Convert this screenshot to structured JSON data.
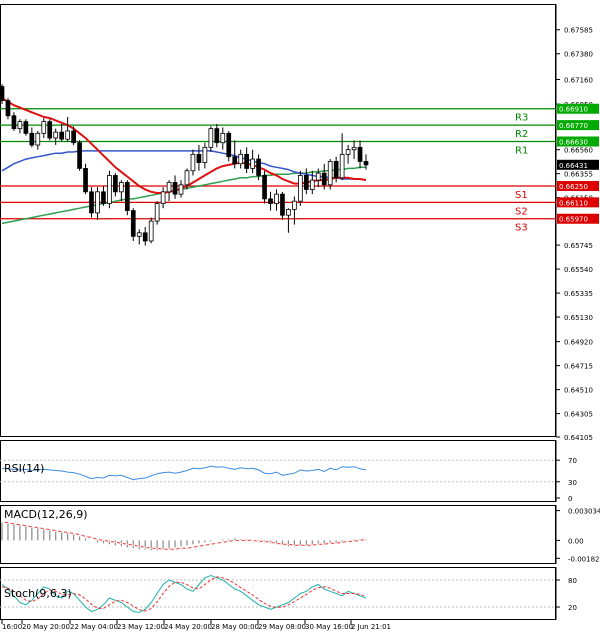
{
  "chart_data": {
    "type": "candlestick",
    "main": {
      "ylim": [
        0.64105,
        0.67805
      ],
      "y_ticks": [
        "0.67585",
        "0.67380",
        "0.67160",
        "0.66950",
        "0.66560",
        "0.66355",
        "0.66150",
        "0.65745",
        "0.65540",
        "0.65335",
        "0.65130",
        "0.64920",
        "0.64715",
        "0.64510",
        "0.64305",
        "0.64105"
      ],
      "price_tags": [
        {
          "value": 0.6691,
          "label": "0.66910",
          "bg": "#00aa00"
        },
        {
          "value": 0.6677,
          "label": "0.66770",
          "bg": "#00aa00"
        },
        {
          "value": 0.6663,
          "label": "0.66630",
          "bg": "#00aa00"
        },
        {
          "value": 0.66431,
          "label": "0.66431",
          "bg": "#000000"
        },
        {
          "value": 0.6625,
          "label": "0.66250",
          "bg": "#dd0000"
        },
        {
          "value": 0.6611,
          "label": "0.66110",
          "bg": "#dd0000"
        },
        {
          "value": 0.6597,
          "label": "0.65970",
          "bg": "#dd0000"
        }
      ],
      "levels": [
        {
          "name": "R3",
          "value": 0.6691,
          "color": "#008800"
        },
        {
          "name": "R2",
          "value": 0.6677,
          "color": "#008800"
        },
        {
          "name": "R1",
          "value": 0.6663,
          "color": "#008800"
        },
        {
          "name": "S1",
          "value": 0.6625,
          "color": "#dd0000"
        },
        {
          "name": "S2",
          "value": 0.6611,
          "color": "#dd0000"
        },
        {
          "name": "S3",
          "value": 0.6597,
          "color": "#dd0000"
        }
      ],
      "candles": [
        [
          0.671,
          0.6712,
          0.6695,
          0.6698
        ],
        [
          0.6698,
          0.67,
          0.6682,
          0.6685
        ],
        [
          0.6685,
          0.6688,
          0.6672,
          0.6674
        ],
        [
          0.6674,
          0.6682,
          0.667,
          0.668
        ],
        [
          0.668,
          0.6682,
          0.6668,
          0.667
        ],
        [
          0.667,
          0.6675,
          0.6658,
          0.666
        ],
        [
          0.666,
          0.6672,
          0.6656,
          0.667
        ],
        [
          0.667,
          0.6683,
          0.6666,
          0.668
        ],
        [
          0.668,
          0.6682,
          0.6664,
          0.6666
        ],
        [
          0.6666,
          0.6674,
          0.666,
          0.6671
        ],
        [
          0.6671,
          0.6678,
          0.6663,
          0.6665
        ],
        [
          0.6665,
          0.6684,
          0.6663,
          0.6672
        ],
        [
          0.6672,
          0.6676,
          0.666,
          0.6662
        ],
        [
          0.6662,
          0.6664,
          0.6638,
          0.664
        ],
        [
          0.664,
          0.6644,
          0.6618,
          0.662
        ],
        [
          0.662,
          0.6624,
          0.6598,
          0.6602
        ],
        [
          0.6602,
          0.6624,
          0.6596,
          0.662
        ],
        [
          0.662,
          0.6625,
          0.6608,
          0.661
        ],
        [
          0.661,
          0.6638,
          0.6606,
          0.6634
        ],
        [
          0.6634,
          0.6636,
          0.6616,
          0.662
        ],
        [
          0.662,
          0.663,
          0.6612,
          0.6628
        ],
        [
          0.6628,
          0.663,
          0.66,
          0.6604
        ],
        [
          0.6604,
          0.6606,
          0.6578,
          0.6582
        ],
        [
          0.6582,
          0.6588,
          0.6575,
          0.6585
        ],
        [
          0.6585,
          0.659,
          0.6574,
          0.6578
        ],
        [
          0.6578,
          0.6598,
          0.6576,
          0.6595
        ],
        [
          0.6595,
          0.6612,
          0.6592,
          0.661
        ],
        [
          0.661,
          0.6624,
          0.6606,
          0.662
        ],
        [
          0.662,
          0.663,
          0.6612,
          0.6628
        ],
        [
          0.6628,
          0.6634,
          0.6614,
          0.6618
        ],
        [
          0.6618,
          0.663,
          0.6615,
          0.6626
        ],
        [
          0.6626,
          0.664,
          0.6622,
          0.6638
        ],
        [
          0.6638,
          0.6656,
          0.6634,
          0.6652
        ],
        [
          0.6652,
          0.666,
          0.6638,
          0.6645
        ],
        [
          0.6645,
          0.6662,
          0.664,
          0.6658
        ],
        [
          0.6658,
          0.6676,
          0.6654,
          0.6674
        ],
        [
          0.6674,
          0.6678,
          0.6658,
          0.6662
        ],
        [
          0.6662,
          0.6675,
          0.6656,
          0.667
        ],
        [
          0.667,
          0.6672,
          0.6646,
          0.665
        ],
        [
          0.665,
          0.6664,
          0.664,
          0.6644
        ],
        [
          0.6644,
          0.6656,
          0.664,
          0.6652
        ],
        [
          0.6652,
          0.6658,
          0.6636,
          0.664
        ],
        [
          0.664,
          0.6656,
          0.6636,
          0.6648
        ],
        [
          0.6648,
          0.6652,
          0.663,
          0.6634
        ],
        [
          0.6634,
          0.6638,
          0.661,
          0.6614
        ],
        [
          0.6614,
          0.662,
          0.6604,
          0.661
        ],
        [
          0.661,
          0.6622,
          0.6604,
          0.6618
        ],
        [
          0.6618,
          0.662,
          0.6596,
          0.66
        ],
        [
          0.66,
          0.6606,
          0.6585,
          0.6605
        ],
        [
          0.6605,
          0.6616,
          0.6592,
          0.6612
        ],
        [
          0.6612,
          0.6638,
          0.6608,
          0.6634
        ],
        [
          0.6634,
          0.664,
          0.6618,
          0.6622
        ],
        [
          0.6622,
          0.6638,
          0.6618,
          0.663
        ],
        [
          0.663,
          0.664,
          0.6624,
          0.6636
        ],
        [
          0.6636,
          0.6644,
          0.6622,
          0.6626
        ],
        [
          0.6626,
          0.6648,
          0.6622,
          0.6646
        ],
        [
          0.6646,
          0.665,
          0.6628,
          0.6632
        ],
        [
          0.6632,
          0.667,
          0.663,
          0.6652
        ],
        [
          0.6652,
          0.666,
          0.6644,
          0.6656
        ],
        [
          0.6656,
          0.6664,
          0.6648,
          0.6658
        ],
        [
          0.6658,
          0.6664,
          0.664,
          0.6646
        ],
        [
          0.6646,
          0.6652,
          0.6639,
          0.6643
        ]
      ],
      "ma_red": [
        0.67,
        0.6697,
        0.6694,
        0.6692,
        0.669,
        0.6688,
        0.6686,
        0.6684,
        0.6683,
        0.6681,
        0.6679,
        0.6677,
        0.6674,
        0.667,
        0.6666,
        0.6661,
        0.6656,
        0.6651,
        0.6646,
        0.6641,
        0.6637,
        0.6633,
        0.6629,
        0.6625,
        0.6622,
        0.662,
        0.6619,
        0.6619,
        0.662,
        0.6621,
        0.6623,
        0.6625,
        0.6628,
        0.6631,
        0.6634,
        0.6637,
        0.664,
        0.6642,
        0.6643,
        0.6644,
        0.6645,
        0.6644,
        0.6643,
        0.6641,
        0.6639,
        0.6636,
        0.6634,
        0.6631,
        0.6629,
        0.6627,
        0.6627,
        0.6628,
        0.6629,
        0.663,
        0.663,
        0.6631,
        0.6632,
        0.6632,
        0.6632,
        0.6631,
        0.6631,
        0.663
      ],
      "ma_blue": [
        0.6638,
        0.6641,
        0.6644,
        0.6646,
        0.6648,
        0.6649,
        0.665,
        0.6651,
        0.6652,
        0.6653,
        0.6653,
        0.6654,
        0.6654,
        0.6655,
        0.6655,
        0.6655,
        0.6655,
        0.6655,
        0.6655,
        0.6655,
        0.6655,
        0.6655,
        0.6655,
        0.6655,
        0.6655,
        0.6655,
        0.6655,
        0.6655,
        0.6655,
        0.6655,
        0.6655,
        0.6655,
        0.6655,
        0.6655,
        0.6655,
        0.6655,
        0.6654,
        0.6653,
        0.6652,
        0.6651,
        0.6649,
        0.6648,
        0.6646,
        0.6645,
        0.6644,
        0.6642,
        0.6641,
        0.664,
        0.6639,
        0.6637,
        0.6636,
        0.6635,
        0.6634,
        0.6633,
        0.6633,
        0.6632,
        0.6632,
        0.6631,
        0.6631,
        0.6631,
        0.6631,
        0.663
      ],
      "ma_green": [
        0.6593,
        0.6594,
        0.6595,
        0.6596,
        0.6597,
        0.6598,
        0.6599,
        0.66,
        0.6601,
        0.6602,
        0.6603,
        0.6604,
        0.6605,
        0.6606,
        0.6607,
        0.6608,
        0.6609,
        0.661,
        0.6611,
        0.6612,
        0.6613,
        0.6614,
        0.6614,
        0.6615,
        0.6616,
        0.6617,
        0.6618,
        0.6619,
        0.662,
        0.6621,
        0.6622,
        0.6623,
        0.6624,
        0.6625,
        0.6626,
        0.6627,
        0.6628,
        0.6629,
        0.663,
        0.6631,
        0.6632,
        0.6632,
        0.6633,
        0.6633,
        0.6634,
        0.6634,
        0.6635,
        0.6635,
        0.6635,
        0.6636,
        0.6636,
        0.6636,
        0.6637,
        0.6637,
        0.6638,
        0.6638,
        0.6639,
        0.6639,
        0.664,
        0.664,
        0.6641,
        0.6641
      ]
    },
    "rsi": {
      "label": "RSI(14)",
      "ylim": [
        0,
        100
      ],
      "ticks": [
        "70",
        "30",
        "0"
      ],
      "values": [
        55,
        54,
        53,
        52,
        53,
        51,
        52,
        53,
        52,
        51,
        50,
        48,
        47,
        44,
        40,
        36,
        38,
        37,
        42,
        41,
        42,
        38,
        34,
        36,
        37,
        41,
        45,
        47,
        48,
        46,
        48,
        51,
        55,
        54,
        56,
        59,
        57,
        58,
        55,
        53,
        56,
        54,
        55,
        52,
        46,
        45,
        48,
        42,
        44,
        46,
        52,
        50,
        51,
        53,
        49,
        55,
        52,
        58,
        57,
        58,
        54,
        52
      ]
    },
    "macd": {
      "label": "MACD(12,26,9)",
      "ylim": [
        -0.002,
        0.0032
      ],
      "ticks": [
        "0.003034",
        "0.00",
        "-0.001826"
      ],
      "hist": [
        0.0018,
        0.0017,
        0.0016,
        0.0015,
        0.0014,
        0.0013,
        0.0012,
        0.0011,
        0.001,
        0.0009,
        0.0008,
        0.0007,
        0.0006,
        0.0004,
        0.0002,
        0.0,
        -0.0002,
        -0.0003,
        -0.0004,
        -0.0005,
        -0.0006,
        -0.0007,
        -0.0008,
        -0.0009,
        -0.0009,
        -0.001,
        -0.001,
        -0.0009,
        -0.0008,
        -0.0007,
        -0.0006,
        -0.0005,
        -0.0004,
        -0.0003,
        -0.0002,
        -0.0001,
        0.0,
        0.0001,
        0.0001,
        0.0002,
        0.0001,
        0.0001,
        0.0,
        -0.0001,
        -0.0002,
        -0.0003,
        -0.0004,
        -0.0005,
        -0.0006,
        -0.0006,
        -0.0005,
        -0.0005,
        -0.0004,
        -0.0003,
        -0.0003,
        -0.0002,
        -0.0002,
        -0.0001,
        0.0,
        0.0001,
        0.0001,
        0.0001
      ],
      "signal": [
        0.0019,
        0.0018,
        0.0017,
        0.0016,
        0.0015,
        0.0014,
        0.0013,
        0.0012,
        0.0011,
        0.001,
        0.0009,
        0.0008,
        0.0007,
        0.0006,
        0.0004,
        0.0003,
        0.0001,
        0.0,
        -0.0001,
        -0.0002,
        -0.0003,
        -0.0004,
        -0.0005,
        -0.0006,
        -0.0007,
        -0.0008,
        -0.0008,
        -0.0009,
        -0.0009,
        -0.0009,
        -0.0008,
        -0.0008,
        -0.0007,
        -0.0006,
        -0.0005,
        -0.0004,
        -0.0003,
        -0.0002,
        -0.0001,
        0.0,
        0.0,
        0.0,
        0.0,
        -0.0001,
        -0.0001,
        -0.0002,
        -0.0003,
        -0.0004,
        -0.0004,
        -0.0005,
        -0.0005,
        -0.0005,
        -0.0005,
        -0.0004,
        -0.0004,
        -0.0003,
        -0.0003,
        -0.0002,
        -0.0001,
        -0.0001,
        0.0,
        0.0001
      ]
    },
    "stoch": {
      "label": "Stoch(9,6,3)",
      "ylim": [
        0,
        100
      ],
      "ticks": [
        "80",
        "20"
      ],
      "k": [
        70,
        60,
        45,
        30,
        25,
        35,
        50,
        65,
        60,
        45,
        40,
        55,
        50,
        35,
        20,
        10,
        15,
        25,
        40,
        35,
        30,
        20,
        10,
        8,
        15,
        30,
        50,
        70,
        80,
        75,
        70,
        60,
        55,
        70,
        85,
        90,
        85,
        80,
        70,
        60,
        55,
        45,
        35,
        25,
        20,
        15,
        20,
        25,
        30,
        40,
        50,
        55,
        65,
        70,
        60,
        55,
        50,
        45,
        55,
        50,
        45,
        40
      ],
      "d": [
        65,
        62,
        55,
        45,
        35,
        32,
        38,
        50,
        58,
        55,
        48,
        47,
        50,
        47,
        38,
        26,
        17,
        17,
        25,
        33,
        35,
        30,
        22,
        14,
        11,
        17,
        31,
        50,
        66,
        75,
        75,
        70,
        62,
        60,
        70,
        80,
        87,
        85,
        80,
        72,
        63,
        55,
        47,
        37,
        28,
        22,
        19,
        20,
        25,
        32,
        40,
        48,
        57,
        63,
        65,
        62,
        55,
        50,
        50,
        50,
        48,
        44
      ]
    },
    "x_labels": [
      "16:00",
      "20 May 20:00",
      "22 May 04:00",
      "23 May 12:00",
      "24 May 20:00",
      "28 May 00:00",
      "29 May 08:00",
      "30 May 16:00",
      "2 Jun 21:01"
    ]
  }
}
